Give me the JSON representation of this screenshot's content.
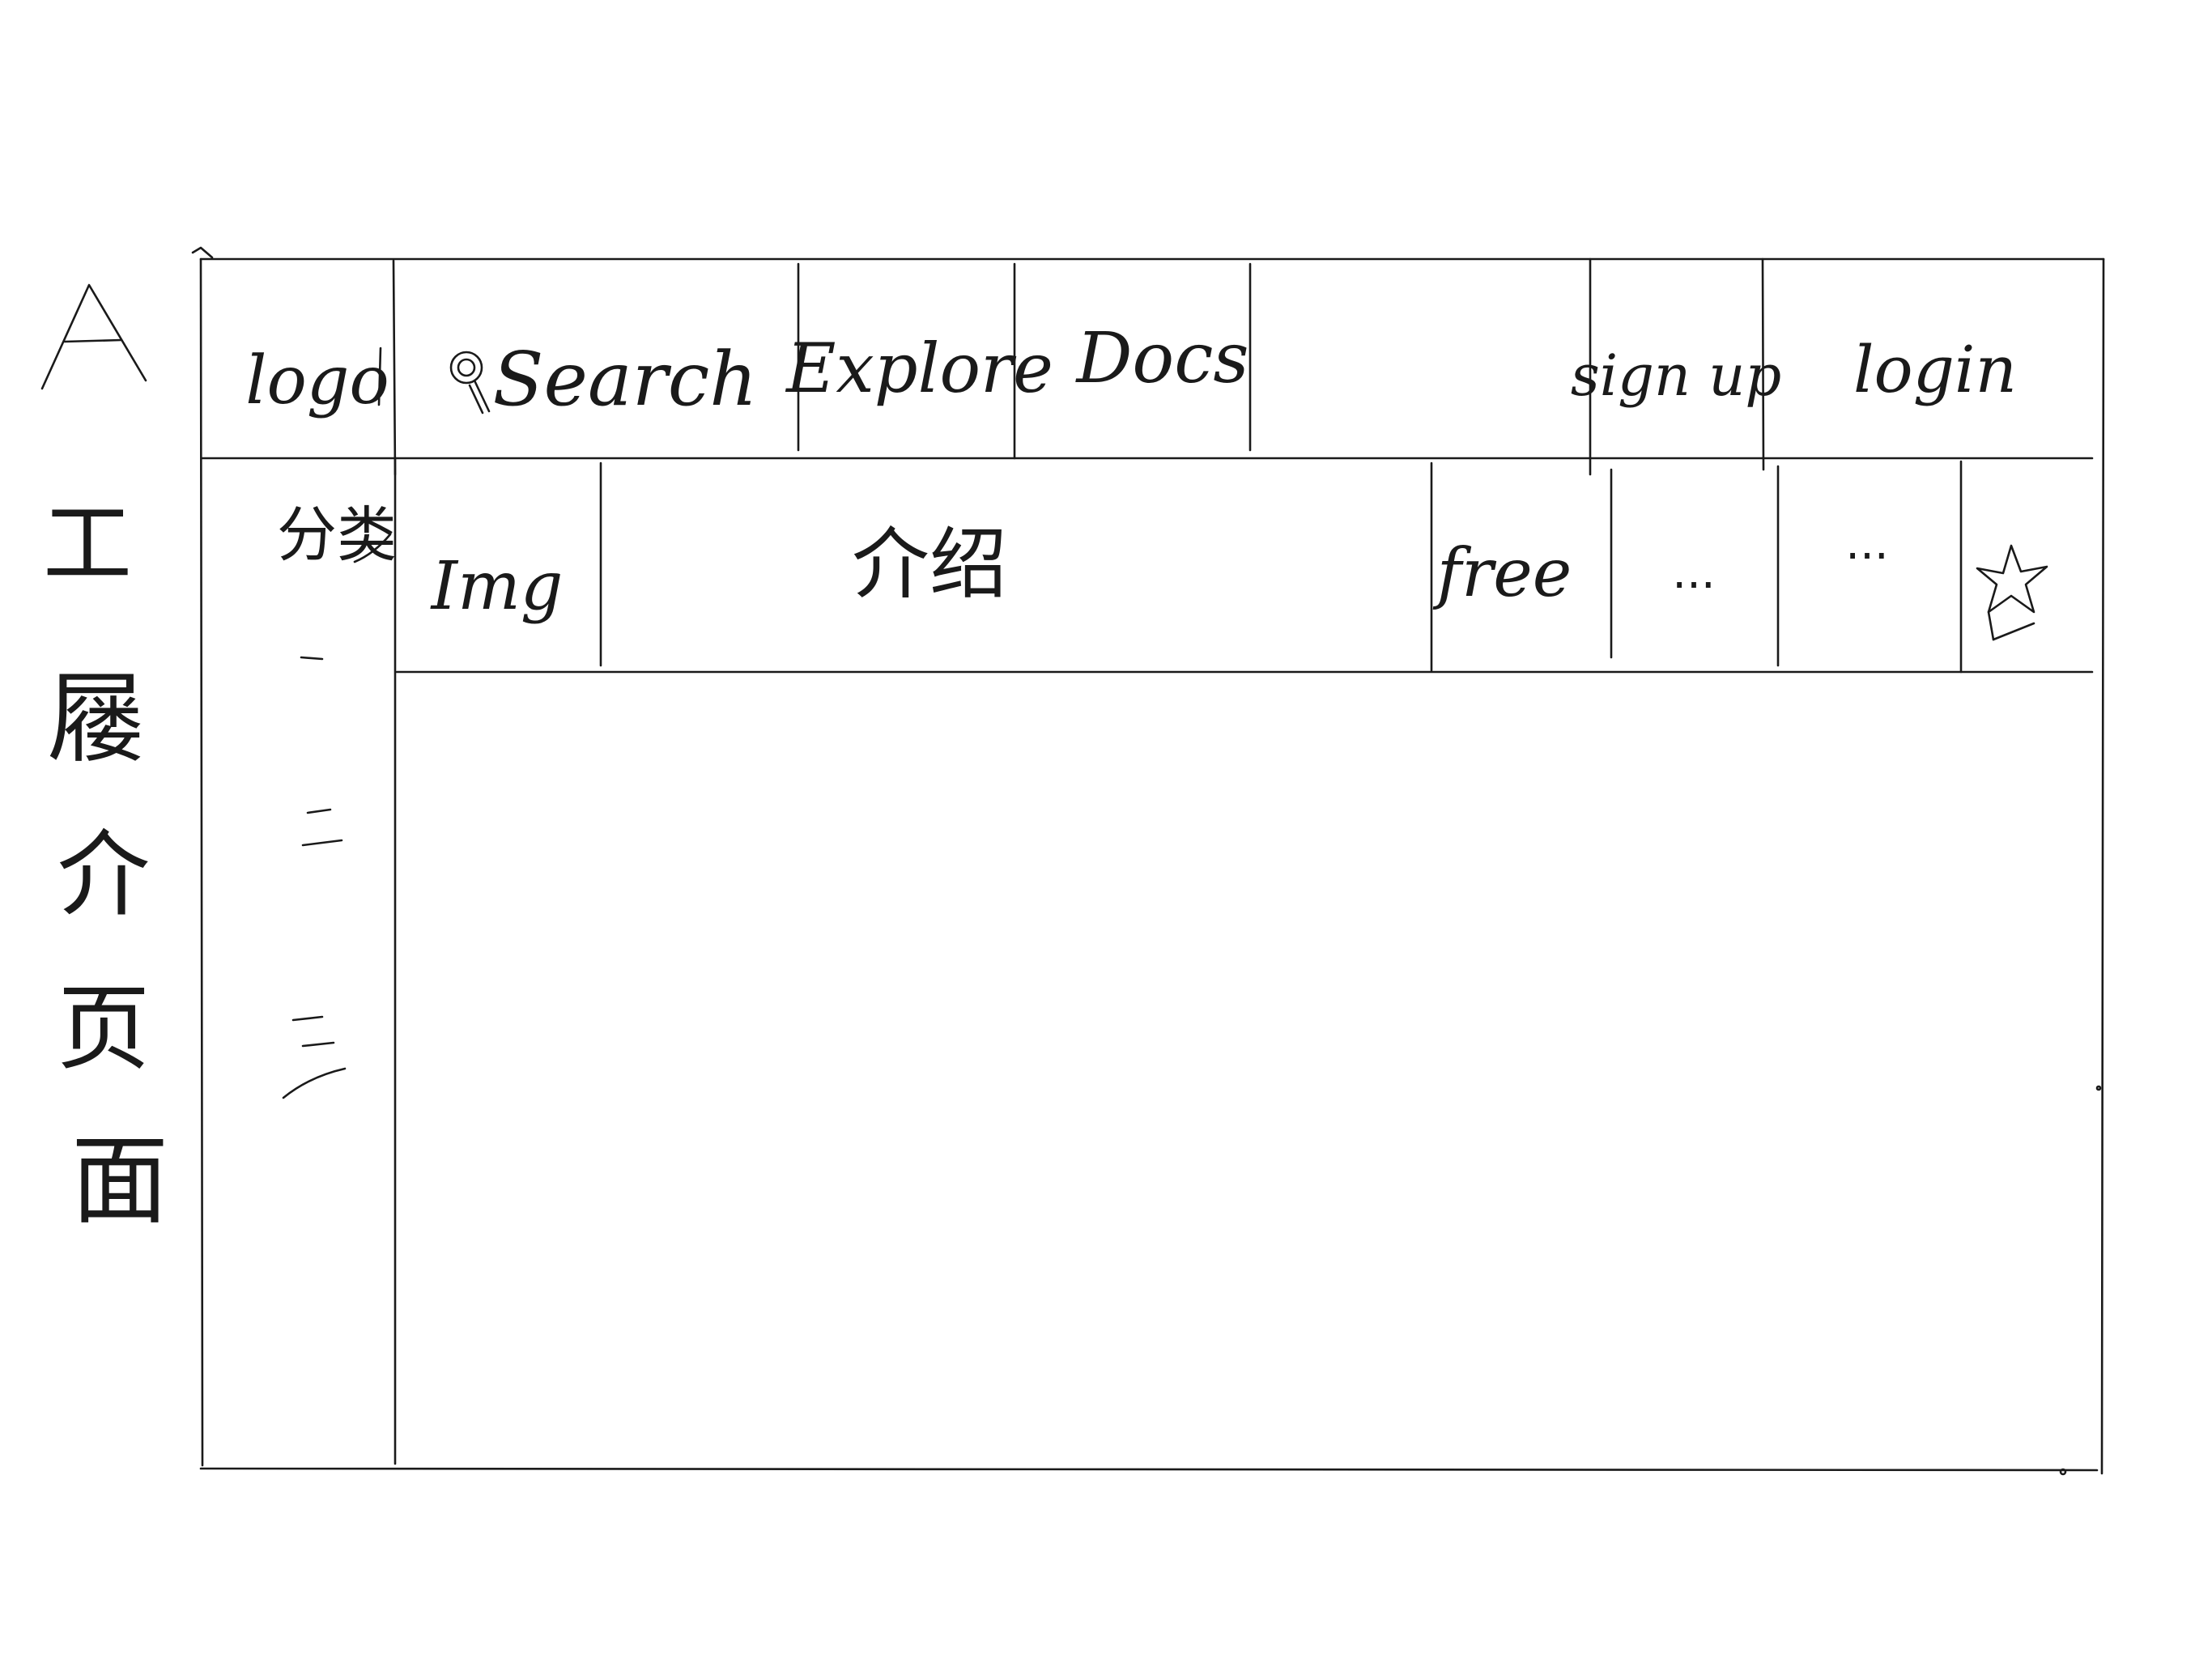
{
  "side_title": {
    "letter": "A",
    "chars": [
      "工",
      "屦",
      "介",
      "页",
      "面"
    ]
  },
  "header": {
    "logo": "logo",
    "search": "Search",
    "explore": "Explore",
    "docs": "Docs",
    "signup": "sign up",
    "login": "login"
  },
  "sidebar": {
    "title": "分类",
    "items": [
      "一",
      "二",
      "三"
    ]
  },
  "card": {
    "img": "Img",
    "intro": "介绍",
    "free": "free",
    "more1": "...",
    "more2": "..."
  },
  "icons": {
    "search": "search-icon",
    "favorite": "star-icon"
  }
}
